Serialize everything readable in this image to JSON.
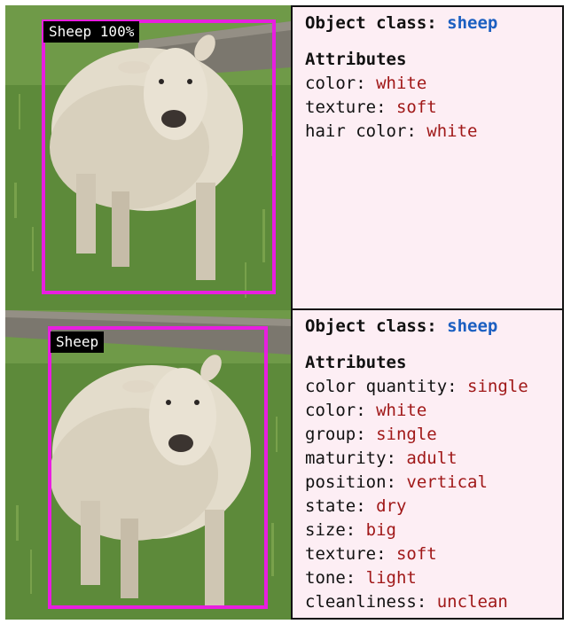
{
  "panels": [
    {
      "detection_label": "Sheep 100%",
      "object_class_label": "Object class:",
      "object_class_value": "sheep",
      "attributes_title": "Attributes",
      "attributes": [
        {
          "key": "color:",
          "value": "white"
        },
        {
          "key": "texture:",
          "value": "soft"
        },
        {
          "key": "hair color:",
          "value": "white"
        }
      ]
    },
    {
      "detection_label": "Sheep",
      "object_class_label": "Object class:",
      "object_class_value": "sheep",
      "attributes_title": "Attributes",
      "attributes": [
        {
          "key": "color quantity:",
          "value": "single"
        },
        {
          "key": "color:",
          "value": "white"
        },
        {
          "key": "group:",
          "value": "single"
        },
        {
          "key": "maturity:",
          "value": "adult"
        },
        {
          "key": "position:",
          "value": "vertical"
        },
        {
          "key": "state:",
          "value": "dry"
        },
        {
          "key": "size:",
          "value": "big"
        },
        {
          "key": "texture:",
          "value": "soft"
        },
        {
          "key": "tone:",
          "value": "light"
        },
        {
          "key": "cleanliness:",
          "value": "unclean"
        }
      ]
    }
  ],
  "colors": {
    "bbox": "#e81ee0",
    "class_value": "#1b5fc1",
    "attribute_value": "#a01818",
    "panel_background": "#fdeef4"
  }
}
